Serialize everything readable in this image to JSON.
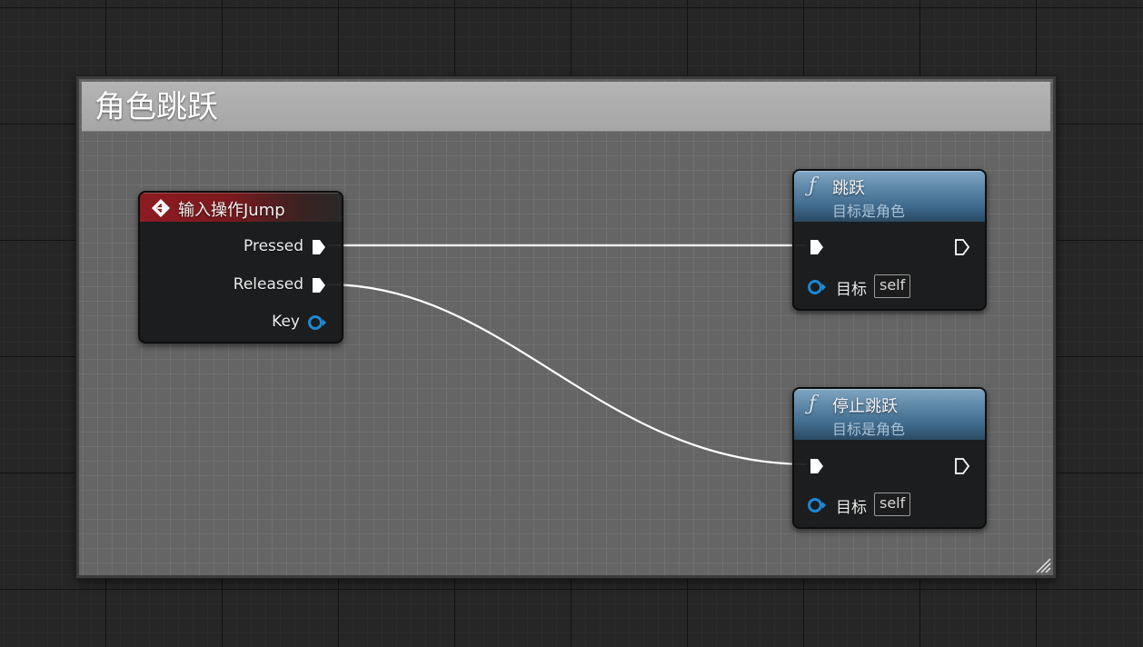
{
  "comment": {
    "title": "角色跳跃"
  },
  "input_node": {
    "title": "输入操作Jump",
    "pins": {
      "pressed": "Pressed",
      "released": "Released",
      "key": "Key"
    }
  },
  "jump_node": {
    "title": "跳跃",
    "subtitle": "目标是角色",
    "target_label": "目标",
    "target_value": "self"
  },
  "stop_jump_node": {
    "title": "停止跳跃",
    "subtitle": "目标是角色",
    "target_label": "目标",
    "target_value": "self"
  },
  "colors": {
    "exec_pin": "#ffffff",
    "object_pin": "#1e88d6",
    "event_header": "#8c1b22",
    "function_header": "#4f7a9c"
  },
  "icons": {
    "event": "event-diamond-icon",
    "function": "function-f-icon",
    "exec": "exec-pin-icon",
    "object": "object-pin-icon",
    "resize": "resize-grip-icon"
  }
}
